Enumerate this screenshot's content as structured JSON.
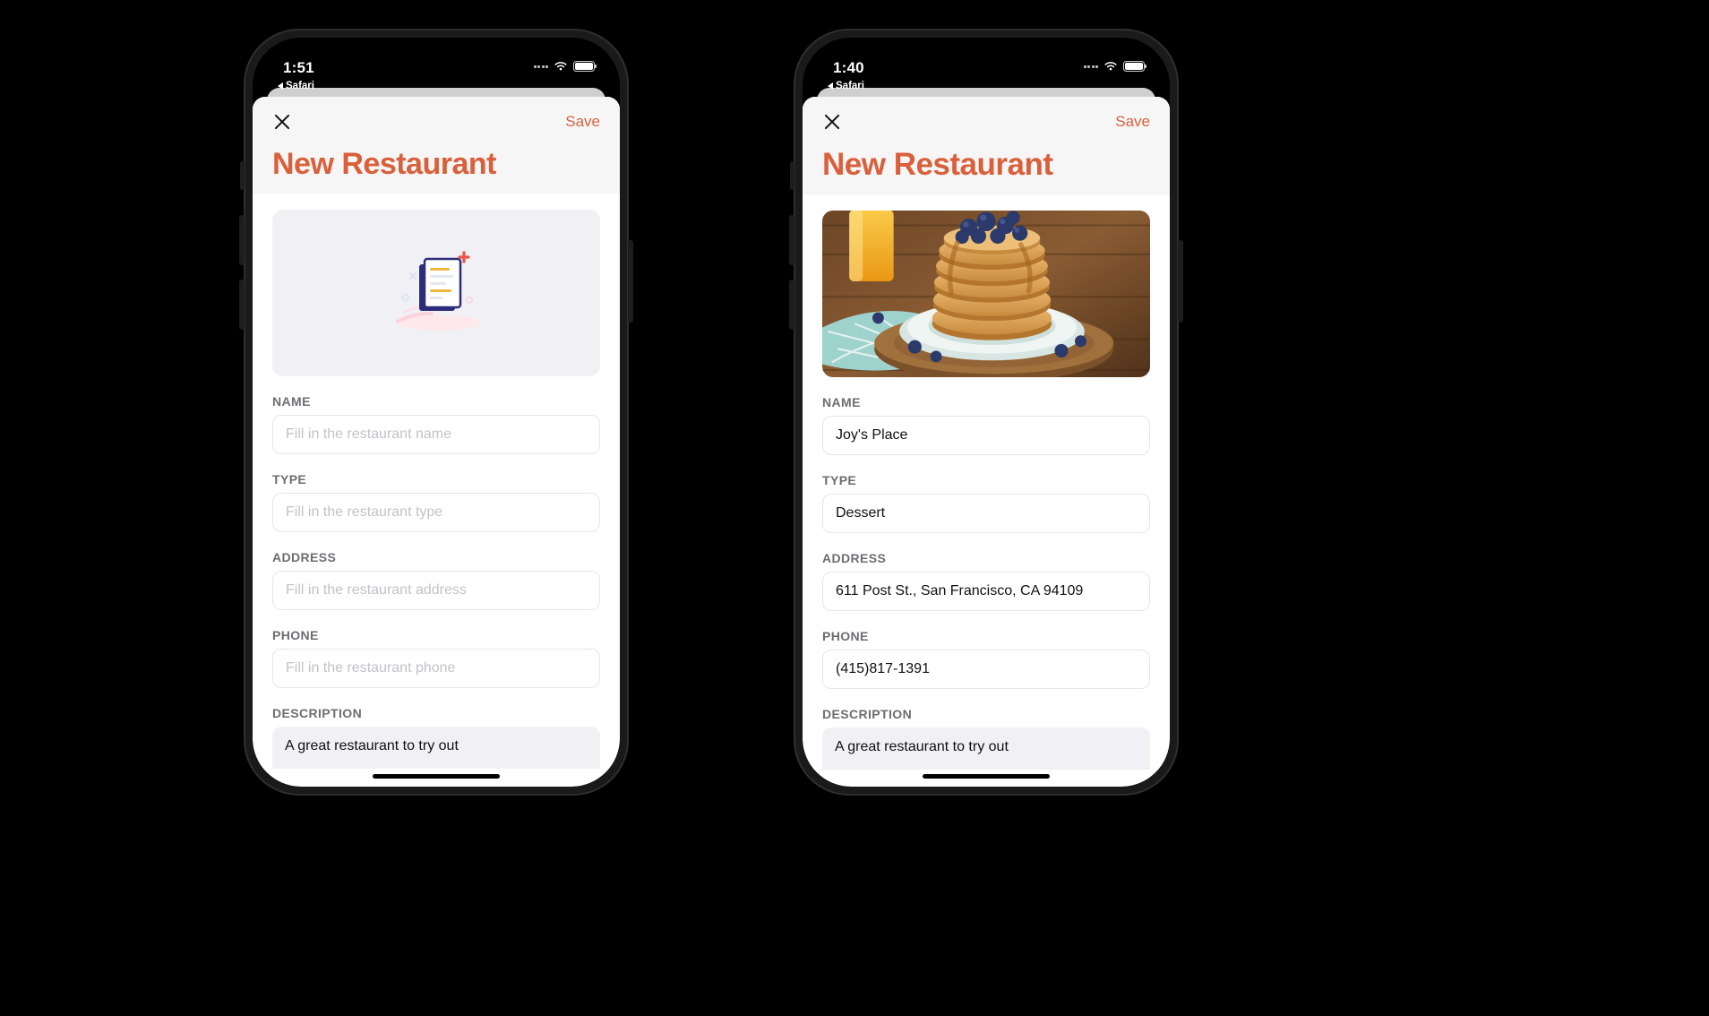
{
  "phones": [
    {
      "id": "left",
      "status": {
        "time": "1:51",
        "back_app": "Safari",
        "back_icon": "back-triangle-icon",
        "wifi_icon": "wifi-icon",
        "battery_icon": "battery-icon",
        "signal_icon": "signal-dots-icon"
      },
      "sheet": {
        "close_icon": "close-icon",
        "save_label": "Save",
        "title": "New Restaurant"
      },
      "photo": {
        "state": "empty",
        "placeholder_icon": "image-placeholder-illustration"
      },
      "fields": [
        {
          "label": "NAME",
          "value": "",
          "placeholder": "Fill in the restaurant name",
          "name": "name-field"
        },
        {
          "label": "TYPE",
          "value": "",
          "placeholder": "Fill in the restaurant type",
          "name": "type-field"
        },
        {
          "label": "ADDRESS",
          "value": "",
          "placeholder": "Fill in the restaurant address",
          "name": "address-field"
        },
        {
          "label": "PHONE",
          "value": "",
          "placeholder": "Fill in the restaurant phone",
          "name": "phone-field"
        }
      ],
      "description": {
        "label": "DESCRIPTION",
        "value": "A great restaurant to try out",
        "placeholder": ""
      }
    },
    {
      "id": "right",
      "status": {
        "time": "1:40",
        "back_app": "Safari",
        "back_icon": "back-triangle-icon",
        "wifi_icon": "wifi-icon",
        "battery_icon": "battery-icon",
        "signal_icon": "signal-dots-icon"
      },
      "sheet": {
        "close_icon": "close-icon",
        "save_label": "Save",
        "title": "New Restaurant"
      },
      "photo": {
        "state": "filled",
        "alt": "stack-of-pancakes-with-blueberries-photo"
      },
      "fields": [
        {
          "label": "NAME",
          "value": "Joy's Place",
          "placeholder": "Fill in the restaurant name",
          "name": "name-field"
        },
        {
          "label": "TYPE",
          "value": "Dessert",
          "placeholder": "Fill in the restaurant type",
          "name": "type-field"
        },
        {
          "label": "ADDRESS",
          "value": "611 Post St., San Francisco, CA 94109",
          "placeholder": "Fill in the restaurant address",
          "name": "address-field"
        },
        {
          "label": "PHONE",
          "value": "(415)817-1391",
          "placeholder": "Fill in the restaurant phone",
          "name": "phone-field"
        }
      ],
      "description": {
        "label": "DESCRIPTION",
        "value": "A great restaurant to try out",
        "placeholder": ""
      }
    }
  ],
  "colors": {
    "accent": "#d9603b",
    "label": "#6d6d72",
    "placeholder": "#c3c2c8",
    "input_border": "#e6e5ea",
    "sheet_header_bg": "#f6f6f6",
    "textarea_bg": "#f1f0f5",
    "background": "#000000"
  }
}
